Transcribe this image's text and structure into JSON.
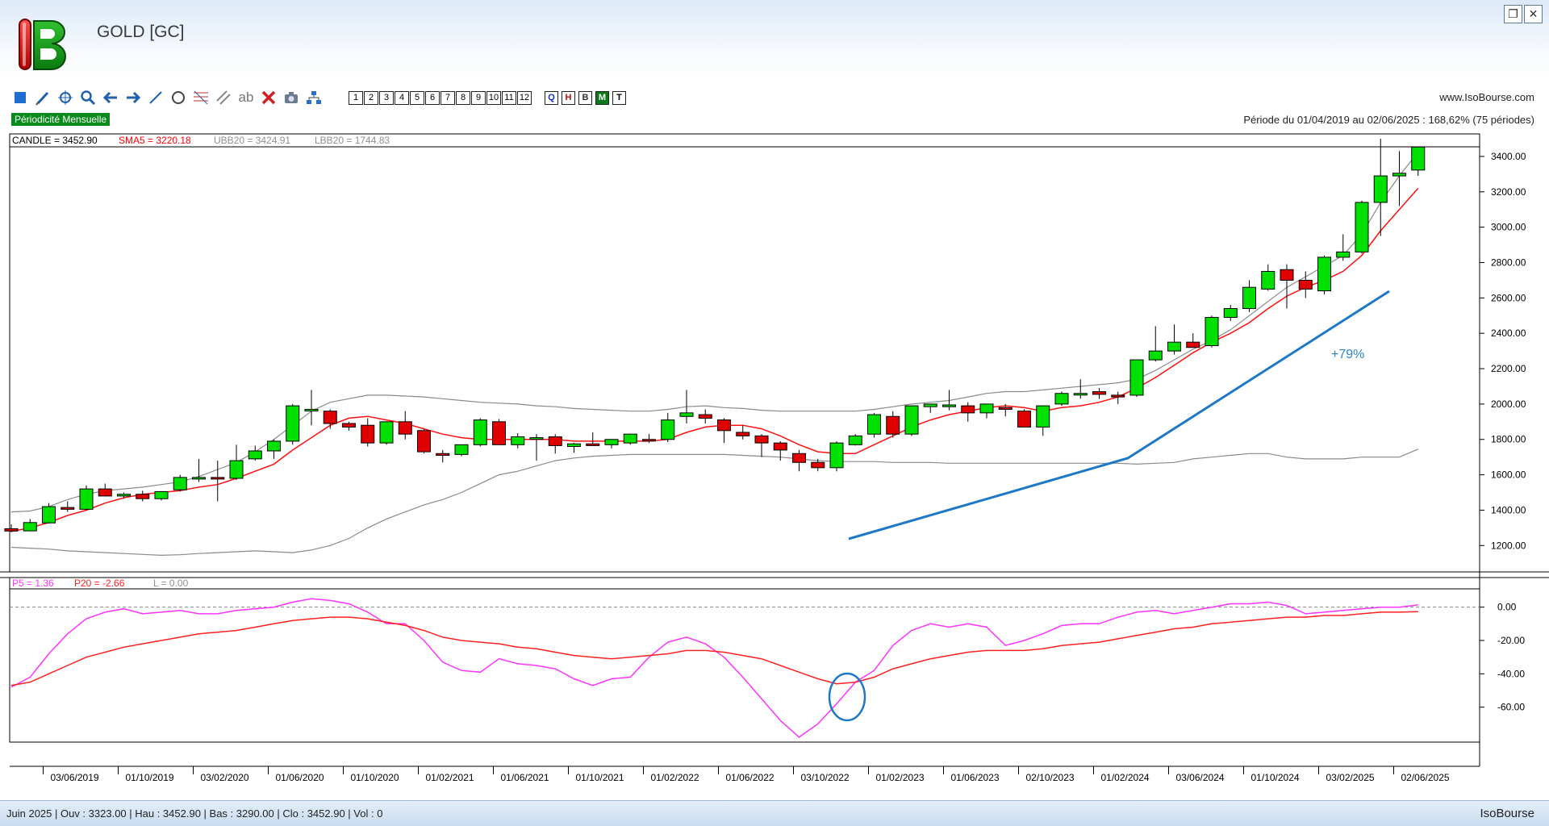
{
  "app": {
    "title": "GOLD [GC]",
    "website": "www.IsoBourse.com",
    "periodicity": "Périodicité Mensuelle",
    "period_info": "Période du 01/04/2019 au 02/06/2025 : 168,62% (75 périodes)",
    "brand": "IsoBourse"
  },
  "toolbar": {
    "icons": [
      "square-icon",
      "pencil-icon",
      "crosshair-icon",
      "zoom-icon",
      "arrow-left-icon",
      "arrow-right-icon",
      "line-icon",
      "circle-icon",
      "fibonacci-icon",
      "channel-icon",
      "text-icon",
      "delete-icon",
      "camera-icon",
      "tree-icon"
    ],
    "text_tool": "ab",
    "numbers": [
      "1",
      "2",
      "3",
      "4",
      "5",
      "6",
      "7",
      "8",
      "9",
      "10",
      "11",
      "12"
    ],
    "periods": [
      {
        "label": "Q",
        "color": "#1030c0",
        "active": false
      },
      {
        "label": "H",
        "color": "#c01010",
        "active": false
      },
      {
        "label": "B",
        "color": "#333333",
        "active": false
      },
      {
        "label": "M",
        "color": "#ffffff",
        "active": true
      },
      {
        "label": "T",
        "color": "#000000",
        "active": false
      }
    ]
  },
  "legend_price": {
    "candle": "CANDLE = 3452.90",
    "sma": "SMA5 = 3220.18",
    "ubb": "UBB20 = 3424.91",
    "lbb": "LBB20 = 1744.83"
  },
  "legend_osc": {
    "p5": "P5 = 1.36",
    "p20": "P20 = -2.66",
    "l": "L = 0.00"
  },
  "annotation": {
    "label": "+79%"
  },
  "status": "Juin 2025 | Ouv : 3323.00 | Hau : 3452.90 | Bas : 3290.00 | Clo : 3452.90 | Vol : 0",
  "chart_data": [
    {
      "type": "candlestick",
      "title": "GOLD [GC]",
      "ylim": [
        1060,
        3500
      ],
      "y_ticks": [
        "1200.00",
        "1400.00",
        "1600.00",
        "1800.00",
        "2000.00",
        "2200.00",
        "2400.00",
        "2600.00",
        "2800.00",
        "3000.00",
        "3200.00",
        "3400.00"
      ],
      "x_ticks": [
        "03/06/2019",
        "01/10/2019",
        "03/02/2020",
        "01/06/2020",
        "01/10/2020",
        "01/02/2021",
        "01/06/2021",
        "01/10/2021",
        "01/02/2022",
        "01/06/2022",
        "03/10/2022",
        "01/02/2023",
        "01/06/2023",
        "02/10/2023",
        "01/02/2024",
        "03/06/2024",
        "01/10/2024",
        "03/02/2025",
        "02/06/2025"
      ],
      "ohlc": [
        [
          1295,
          1320,
          1275,
          1282
        ],
        [
          1283,
          1350,
          1280,
          1330
        ],
        [
          1328,
          1440,
          1325,
          1420
        ],
        [
          1415,
          1450,
          1390,
          1405
        ],
        [
          1405,
          1540,
          1400,
          1520
        ],
        [
          1520,
          1550,
          1480,
          1480
        ],
        [
          1480,
          1500,
          1465,
          1490
        ],
        [
          1490,
          1510,
          1450,
          1465
        ],
        [
          1465,
          1495,
          1455,
          1505
        ],
        [
          1515,
          1600,
          1505,
          1585
        ],
        [
          1585,
          1690,
          1560,
          1585
        ],
        [
          1585,
          1680,
          1450,
          1580
        ],
        [
          1580,
          1770,
          1570,
          1680
        ],
        [
          1690,
          1765,
          1680,
          1735
        ],
        [
          1735,
          1800,
          1690,
          1790
        ],
        [
          1790,
          2000,
          1770,
          1990
        ],
        [
          1970,
          2080,
          1880,
          1970
        ],
        [
          1960,
          1970,
          1860,
          1890
        ],
        [
          1890,
          1900,
          1850,
          1870
        ],
        [
          1880,
          1920,
          1760,
          1780
        ],
        [
          1780,
          1900,
          1770,
          1900
        ],
        [
          1900,
          1960,
          1800,
          1830
        ],
        [
          1850,
          1860,
          1720,
          1730
        ],
        [
          1720,
          1740,
          1670,
          1710
        ],
        [
          1715,
          1770,
          1705,
          1770
        ],
        [
          1770,
          1920,
          1760,
          1910
        ],
        [
          1900,
          1915,
          1770,
          1770
        ],
        [
          1770,
          1835,
          1750,
          1815
        ],
        [
          1810,
          1830,
          1680,
          1810
        ],
        [
          1815,
          1830,
          1720,
          1765
        ],
        [
          1760,
          1780,
          1725,
          1775
        ],
        [
          1775,
          1840,
          1770,
          1765
        ],
        [
          1770,
          1800,
          1750,
          1800
        ],
        [
          1780,
          1830,
          1770,
          1830
        ],
        [
          1800,
          1830,
          1780,
          1795
        ],
        [
          1800,
          1950,
          1785,
          1910
        ],
        [
          1930,
          2080,
          1890,
          1950
        ],
        [
          1940,
          1970,
          1890,
          1920
        ],
        [
          1910,
          1920,
          1780,
          1850
        ],
        [
          1840,
          1880,
          1800,
          1820
        ],
        [
          1820,
          1830,
          1700,
          1780
        ],
        [
          1780,
          1790,
          1680,
          1740
        ],
        [
          1720,
          1740,
          1620,
          1670
        ],
        [
          1670,
          1690,
          1620,
          1640
        ],
        [
          1640,
          1790,
          1620,
          1780
        ],
        [
          1770,
          1830,
          1765,
          1820
        ],
        [
          1830,
          1950,
          1810,
          1940
        ],
        [
          1930,
          1960,
          1810,
          1830
        ],
        [
          1830,
          1990,
          1820,
          1990
        ],
        [
          1985,
          2000,
          1950,
          2000
        ],
        [
          1985,
          2080,
          1965,
          1995
        ],
        [
          1990,
          2010,
          1900,
          1950
        ],
        [
          1950,
          2000,
          1920,
          2000
        ],
        [
          1980,
          2000,
          1930,
          1970
        ],
        [
          1960,
          1970,
          1870,
          1870
        ],
        [
          1870,
          1990,
          1820,
          1990
        ],
        [
          2000,
          2070,
          1990,
          2060
        ],
        [
          2060,
          2140,
          2030,
          2060
        ],
        [
          2070,
          2090,
          2030,
          2055
        ],
        [
          2050,
          2070,
          2000,
          2040
        ],
        [
          2050,
          2250,
          2040,
          2250
        ],
        [
          2250,
          2440,
          2240,
          2300
        ],
        [
          2300,
          2450,
          2280,
          2350
        ],
        [
          2350,
          2400,
          2320,
          2320
        ],
        [
          2330,
          2500,
          2320,
          2490
        ],
        [
          2490,
          2560,
          2470,
          2540
        ],
        [
          2540,
          2700,
          2520,
          2660
        ],
        [
          2650,
          2790,
          2640,
          2750
        ],
        [
          2760,
          2790,
          2540,
          2700
        ],
        [
          2700,
          2750,
          2600,
          2650
        ],
        [
          2640,
          2840,
          2620,
          2830
        ],
        [
          2830,
          2960,
          2810,
          2860
        ],
        [
          2860,
          3150,
          2850,
          3140
        ],
        [
          3140,
          3500,
          2950,
          3290
        ],
        [
          3290,
          3430,
          3120,
          3305
        ],
        [
          3323,
          3452.9,
          3290,
          3452.9
        ]
      ],
      "sma5": [
        1280,
        1300,
        1330,
        1370,
        1400,
        1440,
        1470,
        1490,
        1500,
        1510,
        1530,
        1545,
        1580,
        1620,
        1660,
        1740,
        1810,
        1880,
        1920,
        1930,
        1910,
        1890,
        1860,
        1830,
        1810,
        1800,
        1800,
        1800,
        1800,
        1800,
        1790,
        1790,
        1790,
        1790,
        1790,
        1800,
        1840,
        1870,
        1880,
        1880,
        1860,
        1820,
        1770,
        1730,
        1720,
        1720,
        1770,
        1820,
        1870,
        1910,
        1940,
        1960,
        1980,
        1990,
        1980,
        1960,
        1980,
        1990,
        2010,
        2040,
        2090,
        2150,
        2220,
        2290,
        2350,
        2400,
        2460,
        2540,
        2610,
        2660,
        2700,
        2750,
        2840,
        2980,
        3100,
        3220.18
      ],
      "ubb20": [
        1390,
        1395,
        1420,
        1460,
        1490,
        1510,
        1520,
        1530,
        1545,
        1560,
        1590,
        1630,
        1670,
        1730,
        1800,
        1880,
        1960,
        2010,
        2030,
        2050,
        2050,
        2045,
        2040,
        2030,
        2020,
        2010,
        2005,
        2000,
        1990,
        1985,
        1975,
        1970,
        1965,
        1960,
        1960,
        1970,
        1985,
        1990,
        1980,
        1975,
        1965,
        1960,
        1960,
        1960,
        1960,
        1960,
        1970,
        1985,
        2000,
        2010,
        2020,
        2040,
        2060,
        2070,
        2070,
        2080,
        2090,
        2100,
        2110,
        2120,
        2140,
        2190,
        2250,
        2310,
        2360,
        2420,
        2500,
        2580,
        2660,
        2720,
        2780,
        2840,
        2960,
        3140,
        3290,
        3424.91
      ],
      "lbb20": [
        1190,
        1185,
        1180,
        1170,
        1165,
        1160,
        1155,
        1150,
        1145,
        1148,
        1155,
        1160,
        1165,
        1170,
        1165,
        1160,
        1175,
        1200,
        1240,
        1300,
        1350,
        1390,
        1430,
        1460,
        1500,
        1550,
        1600,
        1620,
        1650,
        1680,
        1695,
        1705,
        1710,
        1715,
        1715,
        1715,
        1715,
        1715,
        1715,
        1710,
        1705,
        1700,
        1690,
        1680,
        1675,
        1675,
        1675,
        1670,
        1670,
        1670,
        1665,
        1665,
        1665,
        1665,
        1665,
        1665,
        1665,
        1665,
        1665,
        1665,
        1660,
        1665,
        1670,
        1690,
        1700,
        1710,
        1720,
        1720,
        1700,
        1690,
        1690,
        1690,
        1700,
        1700,
        1700,
        1744.83
      ]
    },
    {
      "type": "line",
      "ylim": [
        -80,
        10
      ],
      "y_ticks": [
        "0.00",
        "-20.00",
        "-40.00",
        "-60.00"
      ],
      "series": [
        {
          "name": "P5",
          "color": "#ff33ff",
          "values": [
            -48,
            -42,
            -28,
            -16,
            -7,
            -3,
            -1,
            -4,
            -3,
            -2,
            -4,
            -4,
            -2,
            -1,
            0,
            3,
            5,
            4,
            2,
            -3,
            -10,
            -10,
            -20,
            -33,
            -38,
            -39,
            -31,
            -34,
            -35,
            -37,
            -43,
            -47,
            -43,
            -42,
            -30,
            -21,
            -18,
            -22,
            -30,
            -42,
            -55,
            -68,
            -78,
            -70,
            -58,
            -45,
            -38,
            -23,
            -14,
            -10,
            -12,
            -10,
            -12,
            -23,
            -20,
            -16,
            -11,
            -10,
            -10,
            -6,
            -3,
            -2,
            -4,
            -2,
            0,
            2,
            2,
            3,
            1,
            -4,
            -3,
            -2,
            -1,
            0,
            0,
            1.36
          ]
        },
        {
          "name": "P20",
          "color": "#ff2020",
          "values": [
            -47,
            -45,
            -40,
            -35,
            -30,
            -27,
            -24,
            -22,
            -20,
            -18,
            -16,
            -15,
            -14,
            -12,
            -10,
            -8,
            -7,
            -6,
            -6,
            -7,
            -9,
            -11,
            -14,
            -18,
            -20,
            -21,
            -22,
            -24,
            -25,
            -27,
            -29,
            -30,
            -31,
            -30,
            -29,
            -28,
            -26,
            -26,
            -27,
            -29,
            -31,
            -35,
            -39,
            -43,
            -46,
            -45,
            -42,
            -37,
            -34,
            -31,
            -29,
            -27,
            -26,
            -26,
            -26,
            -25,
            -23,
            -22,
            -21,
            -19,
            -17,
            -15,
            -13,
            -12,
            -10,
            -9,
            -8,
            -7,
            -6,
            -6,
            -5,
            -5,
            -4,
            -3,
            -3,
            -2.66
          ]
        }
      ]
    }
  ]
}
